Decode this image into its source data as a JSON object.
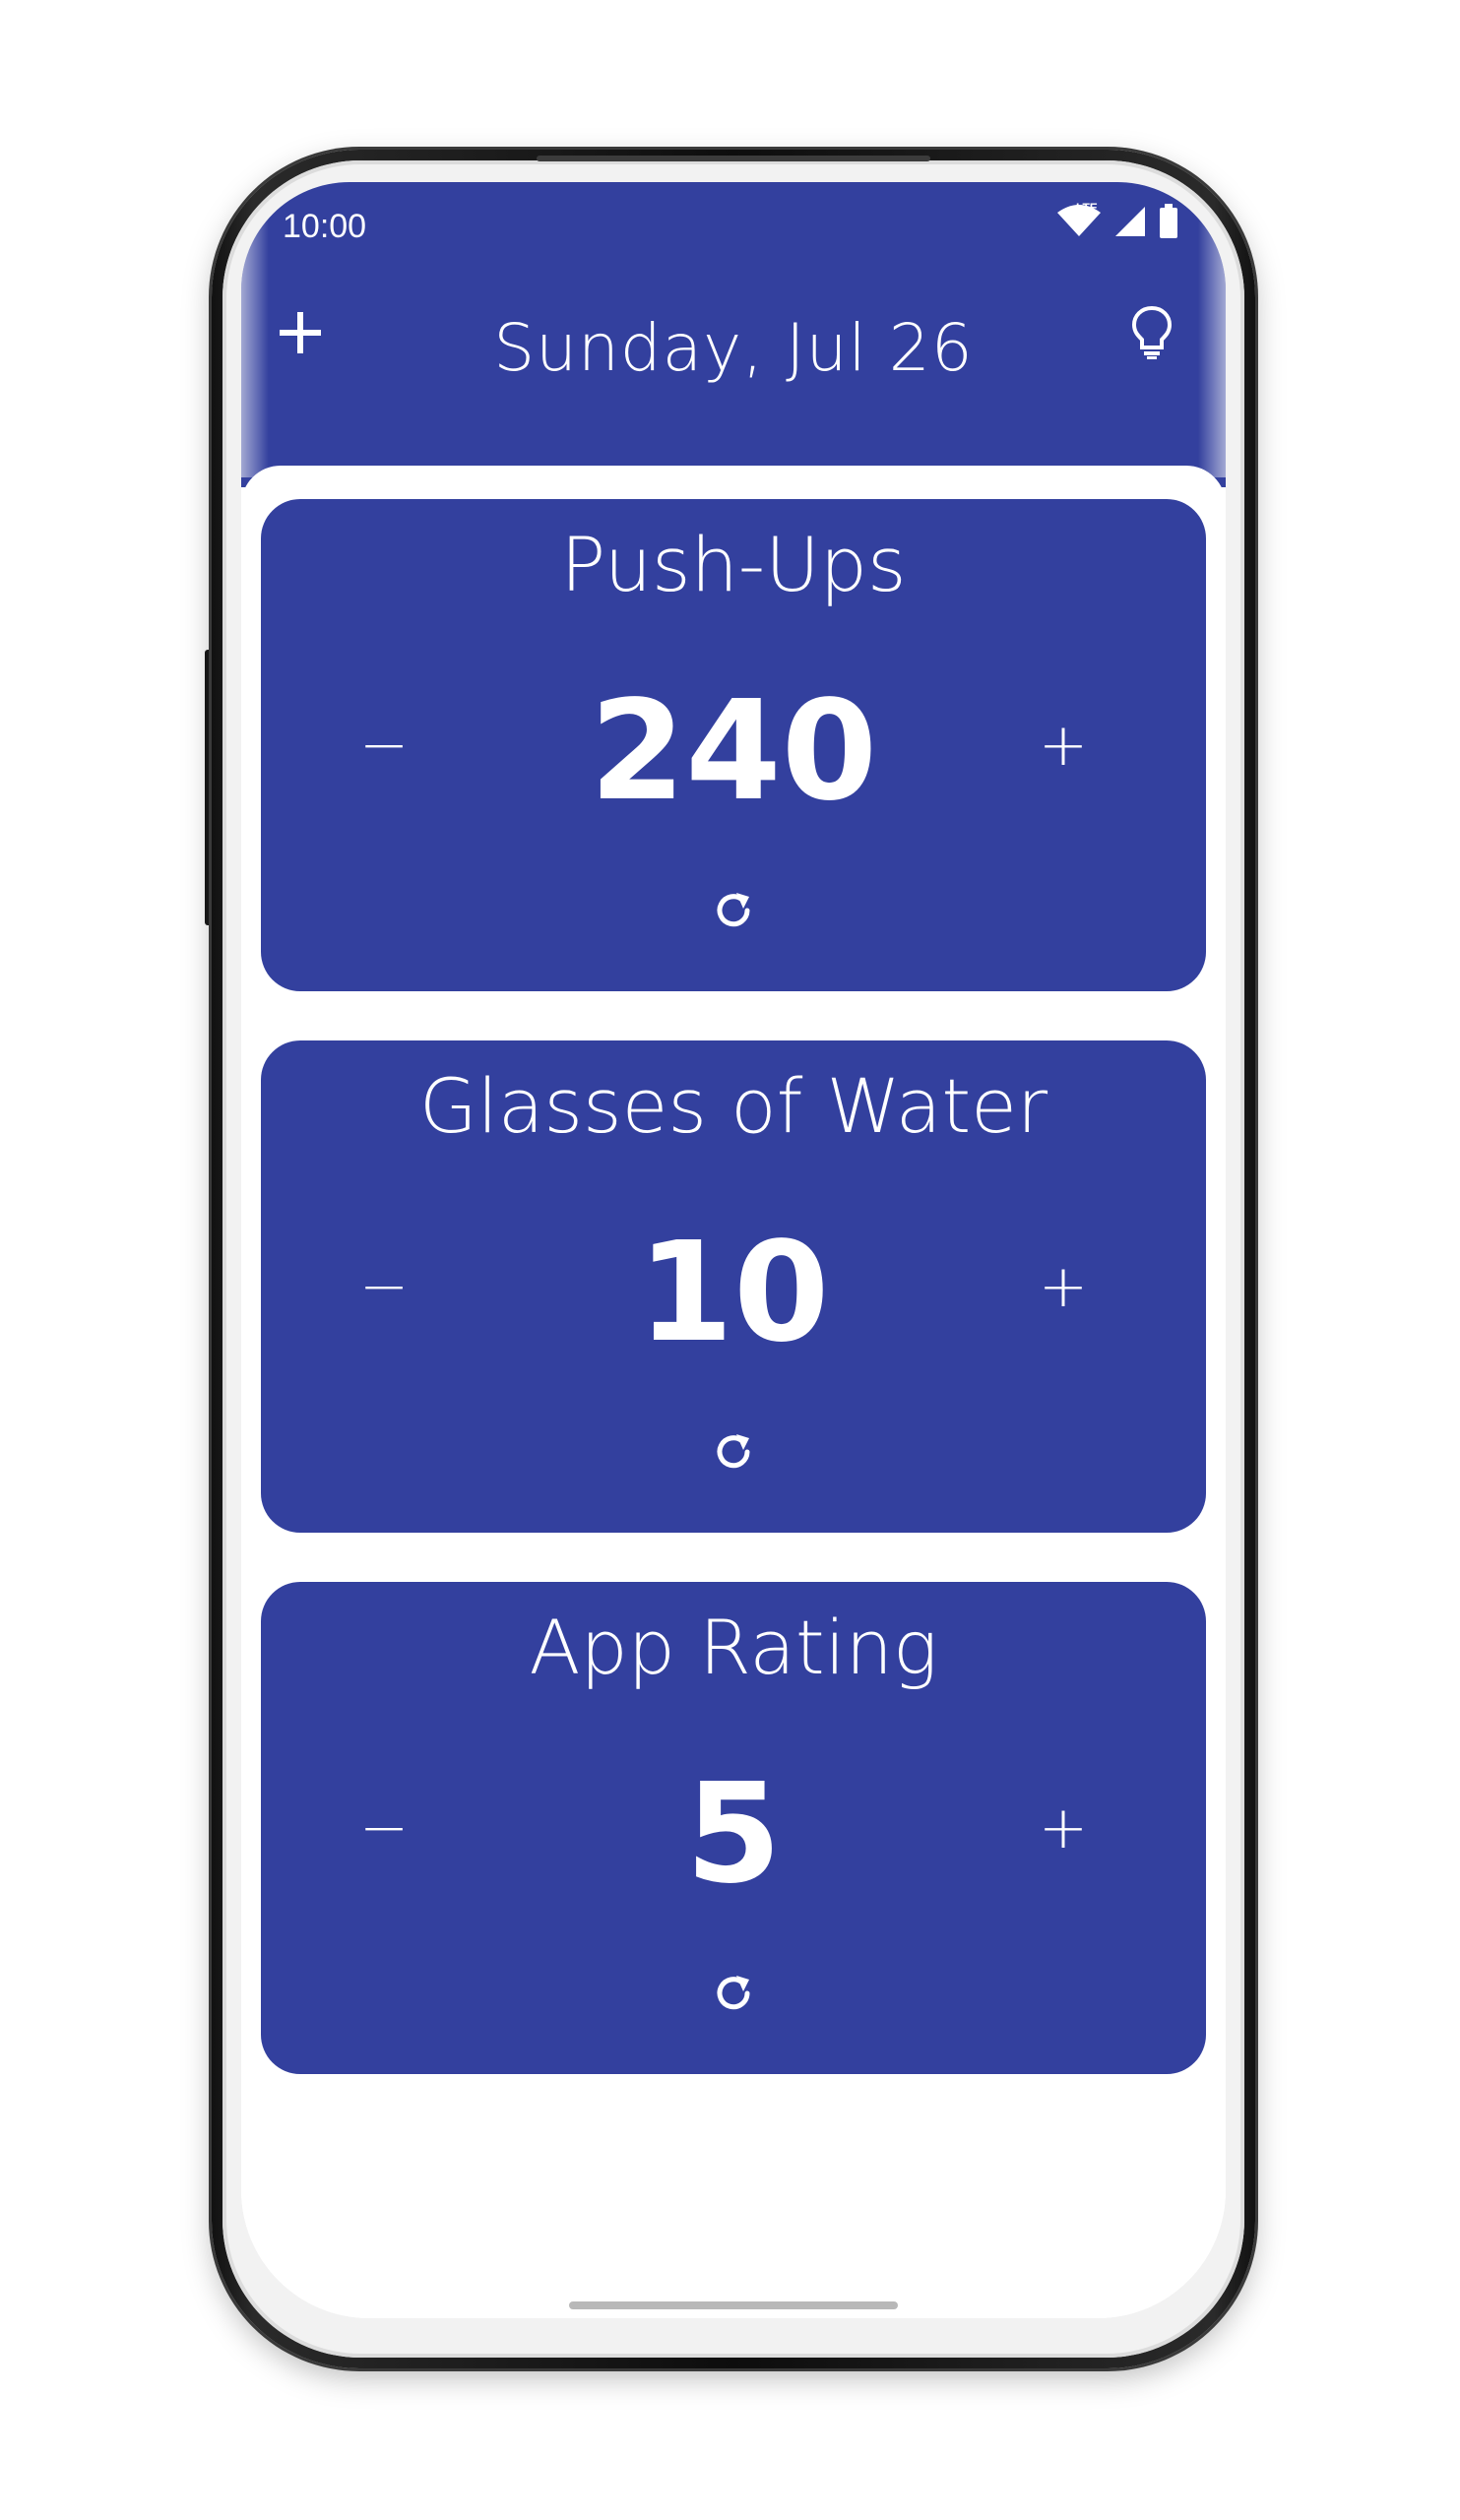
{
  "status_bar": {
    "time": "10:00",
    "network_label": "LTE",
    "icons": [
      "wifi-icon",
      "signal-icon",
      "battery-icon"
    ]
  },
  "header": {
    "title": "Sunday, Jul 26",
    "left_icon": "add-icon",
    "right_icon": "lightbulb-icon"
  },
  "counters": [
    {
      "title": "Push-Ups",
      "count": "240",
      "decrement_label": "−",
      "increment_label": "+",
      "reset_icon": "refresh-icon"
    },
    {
      "title": "Glasses of Water",
      "count": "10",
      "decrement_label": "−",
      "increment_label": "+",
      "reset_icon": "refresh-icon"
    },
    {
      "title": "App Rating",
      "count": "5",
      "decrement_label": "−",
      "increment_label": "+",
      "reset_icon": "refresh-icon"
    }
  ],
  "colors": {
    "primary": "#33409e",
    "background": "#ffffff",
    "text_on_primary": "#ffffff"
  }
}
